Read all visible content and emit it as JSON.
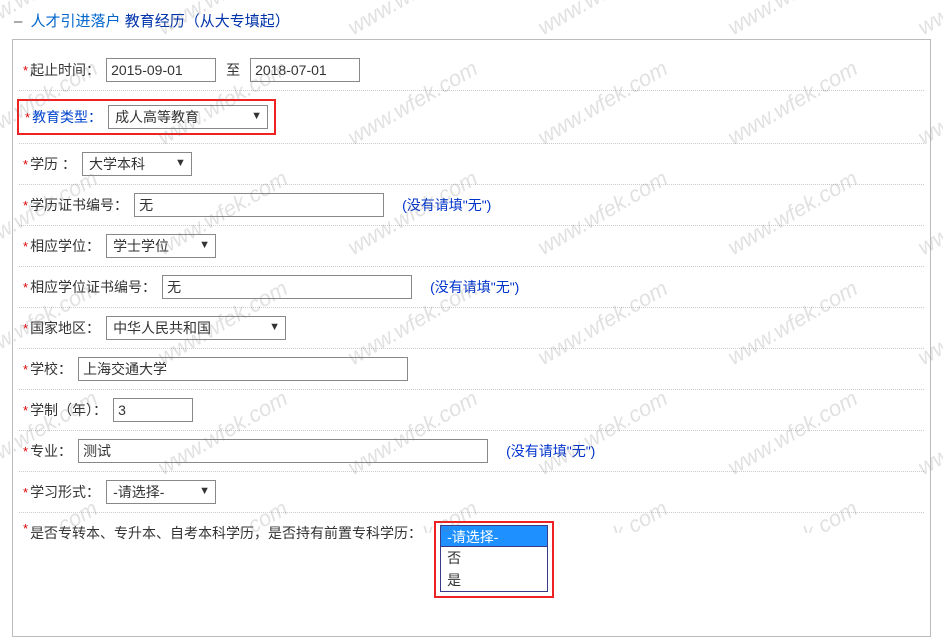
{
  "legend": {
    "dash": "–",
    "part1": "人才引进落户",
    "part2": "教育经历（从大专填起）"
  },
  "rows": {
    "dateRange": {
      "label": "起止时间：",
      "start": "2015-09-01",
      "mid": "至",
      "end": "2018-07-01"
    },
    "eduType": {
      "label": "教育类型：",
      "value": "成人高等教育"
    },
    "degree": {
      "label": "学历 ：",
      "value": "大学本科"
    },
    "certNo": {
      "label": "学历证书编号：",
      "value": "无",
      "hint": "(没有请填\"无\")"
    },
    "degTitle": {
      "label": "相应学位：",
      "value": "学士学位"
    },
    "degCertNo": {
      "label": "相应学位证书编号：",
      "value": "无",
      "hint": "(没有请填\"无\")"
    },
    "country": {
      "label": "国家地区：",
      "value": "中华人民共和国"
    },
    "school": {
      "label": "学校：",
      "value": "上海交通大学"
    },
    "years": {
      "label": "学制（年）：",
      "value": "3"
    },
    "major": {
      "label": "专业：",
      "value": "测试",
      "hint": "(没有请填\"无\")"
    },
    "studyForm": {
      "label": "学习形式：",
      "value": "-请选择-"
    },
    "prevDegree": {
      "label": "是否专转本、专升本、自考本科学历，是否持有前置专科学历：",
      "selected": "-请选择-",
      "opts": [
        "否",
        "是"
      ]
    }
  },
  "watermark": "www.wfek.com"
}
